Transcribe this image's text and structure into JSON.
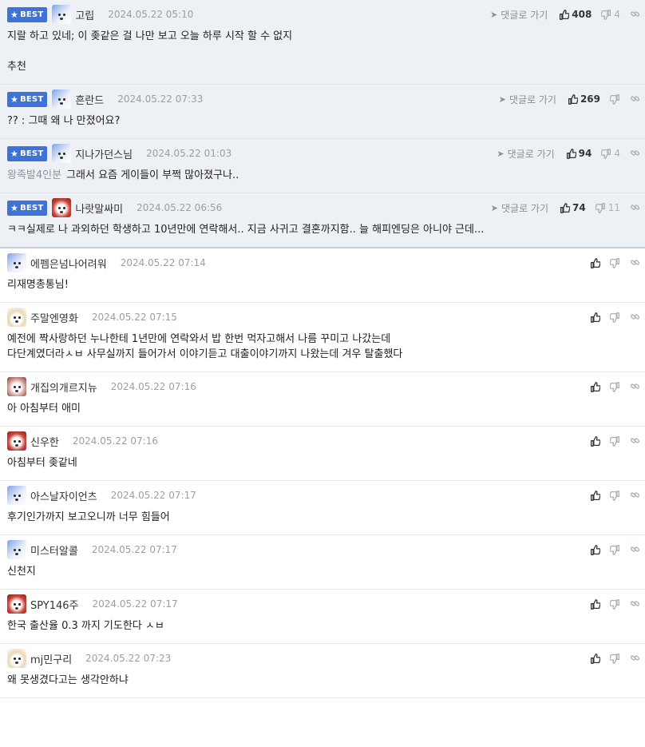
{
  "best_label": "BEST",
  "go_comment_label": "댓글로 가기",
  "best_comments": [
    {
      "avatar": "av-blue",
      "nick": "고립",
      "date": "2024.05.22 05:10",
      "up": "408",
      "down": "4",
      "lines": [
        "지랄 하고 있네; 이 좆같은 걸 나만 보고 오늘 하루 시작 할 수 없지",
        "",
        "추천"
      ],
      "prefix": ""
    },
    {
      "avatar": "av-blue",
      "nick": "흔란드",
      "date": "2024.05.22 07:33",
      "up": "269",
      "down": "",
      "lines": [
        "?? : 그때 왜 나 만졌어요?"
      ],
      "prefix": ""
    },
    {
      "avatar": "av-blue",
      "nick": "지나가던스님",
      "date": "2024.05.22 01:03",
      "up": "94",
      "down": "4",
      "lines": [
        "그래서 요즘 게이들이 부쩍 많아졌구나.."
      ],
      "prefix": "왕족발4인분"
    },
    {
      "avatar": "av-red",
      "nick": "나랏말싸미",
      "date": "2024.05.22 06:56",
      "up": "74",
      "down": "11",
      "lines": [
        "ㅋㅋ실제로 나 과외하던 학생하고 10년만에 연락해서.. 지금 사귀고 결혼까지함.. 늘 해피엔딩은 아니야 근데..."
      ],
      "prefix": ""
    }
  ],
  "comments": [
    {
      "avatar": "av-blue",
      "nick": "에펨은넘나어려워",
      "date": "2024.05.22 07:14",
      "lines": [
        "리재명총통님!"
      ]
    },
    {
      "avatar": "av-fox",
      "nick": "주말엔영화",
      "date": "2024.05.22 07:15",
      "lines": [
        "예전에 짝사랑하던 누나한테 1년만에 연락와서 밥 한번 먹자고해서 나름 꾸미고 나갔는데",
        "다단계였더라ㅅㅂ 사무실까지 들어가서 이야기듣고 대출이야기까지 나왔는데 겨우 탈출했다"
      ]
    },
    {
      "avatar": "av-pink",
      "nick": "개집의개르지뉴",
      "date": "2024.05.22 07:16",
      "lines": [
        "아 아침부터 애미"
      ]
    },
    {
      "avatar": "av-red",
      "nick": "신우한",
      "date": "2024.05.22 07:16",
      "lines": [
        "아침부터 좆같네"
      ]
    },
    {
      "avatar": "av-blue",
      "nick": "아스날자이언츠",
      "date": "2024.05.22 07:17",
      "lines": [
        "후기인가까지 보고오니까 너무 힘들어"
      ]
    },
    {
      "avatar": "av-blue",
      "nick": "미스터알콜",
      "date": "2024.05.22 07:17",
      "lines": [
        "신천지"
      ]
    },
    {
      "avatar": "av-red",
      "nick": "SPY146주",
      "date": "2024.05.22 07:17",
      "lines": [
        "한국 출산율 0.3 까지 기도한다 ㅅㅂ"
      ]
    },
    {
      "avatar": "av-fox",
      "nick": "mj민구리",
      "date": "2024.05.22 07:23",
      "lines": [
        "왜 못생겼다고는 생각안하냐"
      ]
    }
  ]
}
